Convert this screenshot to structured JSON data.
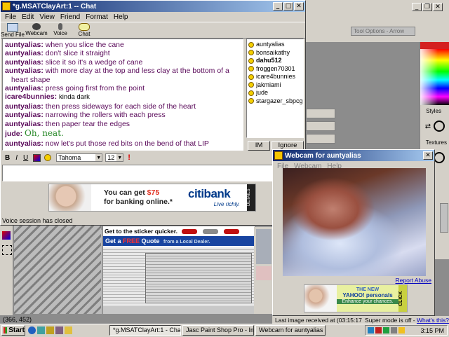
{
  "chat": {
    "title": "*g.MSATClayArt:1 -- Chat",
    "menu": [
      "File",
      "Edit",
      "View",
      "Friend",
      "Format",
      "Help"
    ],
    "toolbar": [
      "Send File",
      "Webcam",
      "Voice",
      "Chat"
    ],
    "messages": [
      {
        "user": "auntyalias:",
        "text": "when you slice the cane"
      },
      {
        "user": "auntyalias:",
        "text": "don't slice it straight"
      },
      {
        "user": "auntyalias:",
        "text": "slice it so it's a wedge of cane"
      },
      {
        "user": "auntyalias:",
        "text": "with more clay at the top and less clay at the bottom of a"
      },
      {
        "user": "",
        "text": "heart shape"
      },
      {
        "user": "auntyalias:",
        "text": "press going first from the point"
      },
      {
        "user": "icare4bunnies:",
        "text": "kinda dark"
      },
      {
        "user": "auntyalias:",
        "text": "then press sideways for each side of the heart"
      },
      {
        "user": "auntyalias:",
        "text": "narrowing the rollers with each press"
      },
      {
        "user": "auntyalias:",
        "text": "then paper tear the edges"
      },
      {
        "user": "jude:",
        "text": "Oh, neat."
      },
      {
        "user": "auntyalias:",
        "text": "now let's put those red bits on the bend of that LIP"
      }
    ],
    "buddies": [
      "auntyalias",
      "bonsaikathy",
      "dahu512",
      "froggen70301",
      "icare4bunnies",
      "jakmiami",
      "jude",
      "stargazer_sbpcg"
    ],
    "im_button": "IM",
    "ignore_button": "Ignore User",
    "font_name": "Tahoma",
    "font_size": "12",
    "format_b": "B",
    "format_i": "I",
    "format_u": "U",
    "status": "Voice session has closed",
    "ad_line1": "You can get ",
    "ad_amount": "$75",
    "ad_line2": "for banking online.*",
    "ad_brand": "citibank",
    "ad_slogan": "Live richly.",
    "ad_details": "DETAILS"
  },
  "webcam": {
    "title": "Webcam for auntyalias",
    "menu": [
      "File",
      "Webcam",
      "Help"
    ],
    "report": "Report Abuse",
    "ad_new": "THE NEW",
    "ad_brand": "YAHOO! personals",
    "ad_tag": "Enhance your chances.",
    "ad_click": "CLICK",
    "status": "Last image received at (03:15:17 PM)",
    "super": "Super mode is off - ",
    "whats": "What's this?"
  },
  "psp": {
    "coords": "(366, 452)",
    "tool_options": "Tool Options - Arrow",
    "styles": "Styles",
    "textures": "Textures",
    "sticker_ad": "Get to the sticker quicker.",
    "quote_ad_1": "Get a ",
    "quote_ad_2": "FREE",
    "quote_ad_3": " Quote",
    "quote_ad_4": "from a Local Dealer."
  },
  "taskbar": {
    "start": "Start",
    "tasks": [
      "*g.MSATClayArt:1 - Chat",
      "Jasc Paint Shop Pro - Ima...",
      "Webcam for auntyalias"
    ],
    "clock": "3:15 PM"
  }
}
